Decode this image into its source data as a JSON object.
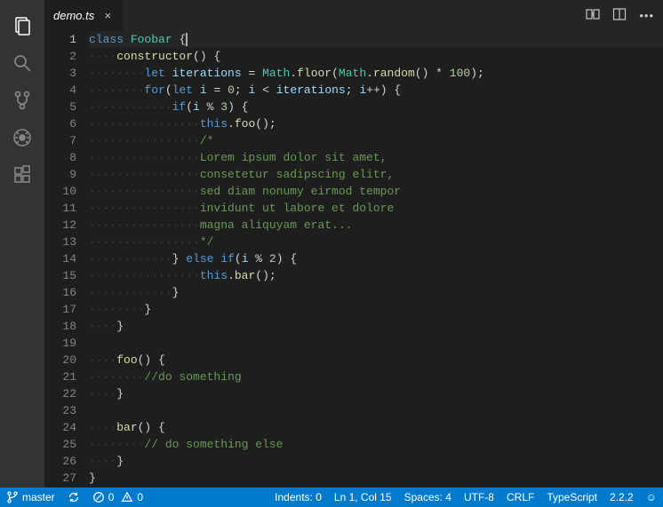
{
  "tab": {
    "filename": "demo.ts",
    "close_glyph": "×"
  },
  "cursor_line": 1,
  "code_lines": [
    [
      {
        "cls": "kw",
        "t": "class"
      },
      {
        "t": " "
      },
      {
        "cls": "cls",
        "t": "Foobar"
      },
      {
        "t": " {"
      },
      {
        "cursor": true
      }
    ],
    [
      {
        "ws": 1
      },
      {
        "cls": "fn",
        "t": "constructor"
      },
      {
        "t": "() {"
      }
    ],
    [
      {
        "ws": 2
      },
      {
        "cls": "kw",
        "t": "let"
      },
      {
        "t": " "
      },
      {
        "cls": "var",
        "t": "iterations"
      },
      {
        "t": " = "
      },
      {
        "cls": "obj",
        "t": "Math"
      },
      {
        "t": "."
      },
      {
        "cls": "fn",
        "t": "floor"
      },
      {
        "t": "("
      },
      {
        "cls": "obj",
        "t": "Math"
      },
      {
        "t": "."
      },
      {
        "cls": "fn",
        "t": "random"
      },
      {
        "t": "() * "
      },
      {
        "cls": "num",
        "t": "100"
      },
      {
        "t": ");"
      }
    ],
    [
      {
        "ws": 2
      },
      {
        "cls": "kw",
        "t": "for"
      },
      {
        "t": "("
      },
      {
        "cls": "kw",
        "t": "let"
      },
      {
        "t": " "
      },
      {
        "cls": "var",
        "t": "i"
      },
      {
        "t": " = "
      },
      {
        "cls": "num",
        "t": "0"
      },
      {
        "t": "; "
      },
      {
        "cls": "var",
        "t": "i"
      },
      {
        "t": " < "
      },
      {
        "cls": "var",
        "t": "iterations"
      },
      {
        "t": "; "
      },
      {
        "cls": "var",
        "t": "i"
      },
      {
        "t": "++) {"
      }
    ],
    [
      {
        "ws": 3
      },
      {
        "cls": "kw",
        "t": "if"
      },
      {
        "t": "("
      },
      {
        "cls": "var",
        "t": "i"
      },
      {
        "t": " % "
      },
      {
        "cls": "num",
        "t": "3"
      },
      {
        "t": ") {"
      }
    ],
    [
      {
        "ws": 4
      },
      {
        "cls": "kw",
        "t": "this"
      },
      {
        "t": "."
      },
      {
        "cls": "fn",
        "t": "foo"
      },
      {
        "t": "();"
      }
    ],
    [
      {
        "ws": 4
      },
      {
        "cls": "cmt",
        "t": "/*"
      }
    ],
    [
      {
        "ws": 4
      },
      {
        "cls": "cmt",
        "t": "Lorem ipsum dolor sit amet,"
      }
    ],
    [
      {
        "ws": 4
      },
      {
        "cls": "cmt",
        "t": "consetetur sadipscing elitr,"
      }
    ],
    [
      {
        "ws": 4
      },
      {
        "cls": "cmt",
        "t": "sed diam nonumy eirmod tempor"
      }
    ],
    [
      {
        "ws": 4
      },
      {
        "cls": "cmt",
        "t": "invidunt ut labore et dolore"
      }
    ],
    [
      {
        "ws": 4
      },
      {
        "cls": "cmt",
        "t": "magna aliquyam erat..."
      }
    ],
    [
      {
        "ws": 4
      },
      {
        "cls": "cmt",
        "t": "*/"
      }
    ],
    [
      {
        "ws": 3
      },
      {
        "t": "} "
      },
      {
        "cls": "kw",
        "t": "else"
      },
      {
        "t": " "
      },
      {
        "cls": "kw",
        "t": "if"
      },
      {
        "t": "("
      },
      {
        "cls": "var",
        "t": "i"
      },
      {
        "t": " % "
      },
      {
        "cls": "num",
        "t": "2"
      },
      {
        "t": ") {"
      }
    ],
    [
      {
        "ws": 4
      },
      {
        "cls": "kw",
        "t": "this"
      },
      {
        "t": "."
      },
      {
        "cls": "fn",
        "t": "bar"
      },
      {
        "t": "();"
      }
    ],
    [
      {
        "ws": 3
      },
      {
        "t": "}"
      }
    ],
    [
      {
        "ws": 2
      },
      {
        "t": "}"
      }
    ],
    [
      {
        "ws": 1
      },
      {
        "t": "}"
      }
    ],
    [
      {
        "t": ""
      }
    ],
    [
      {
        "ws": 1
      },
      {
        "cls": "fn",
        "t": "foo"
      },
      {
        "t": "() {"
      }
    ],
    [
      {
        "ws": 2
      },
      {
        "cls": "cmt",
        "t": "//do something"
      }
    ],
    [
      {
        "ws": 1
      },
      {
        "t": "}"
      }
    ],
    [
      {
        "t": ""
      }
    ],
    [
      {
        "ws": 1
      },
      {
        "cls": "fn",
        "t": "bar"
      },
      {
        "t": "() {"
      }
    ],
    [
      {
        "ws": 2
      },
      {
        "cls": "cmt",
        "t": "// do something else"
      }
    ],
    [
      {
        "ws": 1
      },
      {
        "t": "}"
      }
    ],
    [
      {
        "t": "}"
      },
      {
        "cursormatch": true
      }
    ]
  ],
  "status": {
    "branch_icon": "⎇",
    "branch": "master",
    "errors_icon": "⊘",
    "errors": "0",
    "warnings_icon": "⚠",
    "warnings": "0",
    "indents_label": "Indents: 0",
    "cursor_label": "Ln 1, Col 15",
    "spaces_label": "Spaces: 4",
    "encoding": "UTF-8",
    "eol": "CRLF",
    "language": "TypeScript",
    "version": "2.2.2",
    "feedback_glyph": "☺"
  }
}
